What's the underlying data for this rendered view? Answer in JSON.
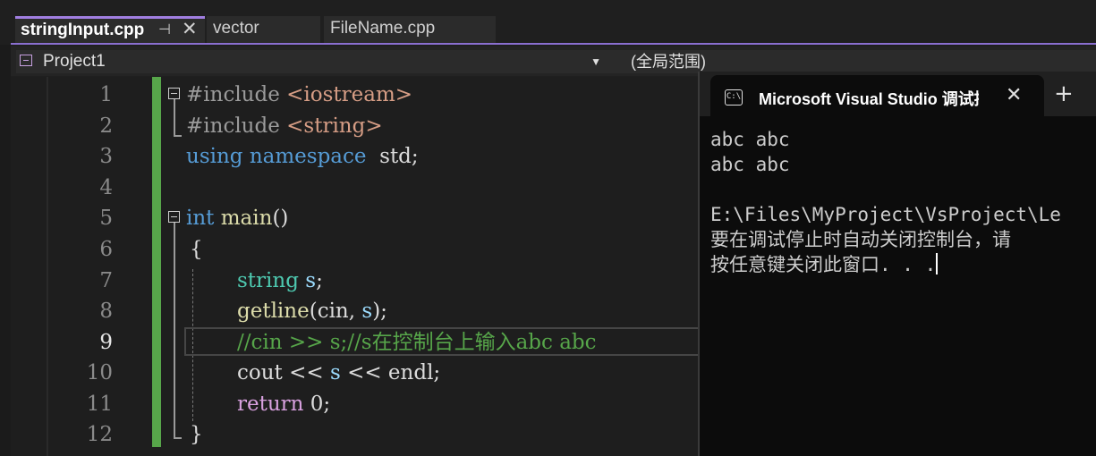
{
  "tabs": [
    {
      "label": "stringInput.cpp",
      "active": true
    },
    {
      "label": "vector"
    },
    {
      "label": "FileName.cpp"
    }
  ],
  "tab_icons": {
    "pin": "⊣",
    "close": "✕"
  },
  "navbar": {
    "project": "Project1",
    "scope": "(全局范围)"
  },
  "editor": {
    "line_numbers": [
      "1",
      "2",
      "3",
      "4",
      "5",
      "6",
      "7",
      "8",
      "9",
      "10",
      "11",
      "12"
    ],
    "current_line": "9",
    "lines": {
      "l1_pp": "#include ",
      "l1_str": "<iostream>",
      "l2_pp": "#include ",
      "l2_str": "<string>",
      "l3_kw1": "using",
      "l3_kw2": "namespace",
      "l3_rest": "  std;",
      "l5_kw": "int",
      "l5_fn": " main",
      "l5_rest": "()",
      "l6": "{",
      "l7_typ": "string",
      "l7_var": " s",
      "l7_rest": ";",
      "l8_fn": "getline",
      "l8_a": "(cin, ",
      "l8_var": "s",
      "l8_b": ");",
      "l9_com": "//cin >> s;//s在控制台上输入abc abc",
      "l10_a": "cout << ",
      "l10_var": "s",
      "l10_b": " << endl;",
      "l11_kw": "return",
      "l11_rest": " 0;",
      "l12": "}"
    }
  },
  "console": {
    "title": "Microsoft Visual Studio 调试控制台",
    "add": "+",
    "output": [
      "abc abc",
      "abc abc",
      "",
      "E:\\Files\\MyProject\\VsProject\\Le",
      "要在调试停止时自动关闭控制台，请",
      "按任意键关闭此窗口. . ."
    ]
  },
  "colors": {
    "accent": "#8a6fd0",
    "change_bar": "#57a64a",
    "editor_bg": "#1e1e1e",
    "console_bg": "#0c0c0c"
  }
}
